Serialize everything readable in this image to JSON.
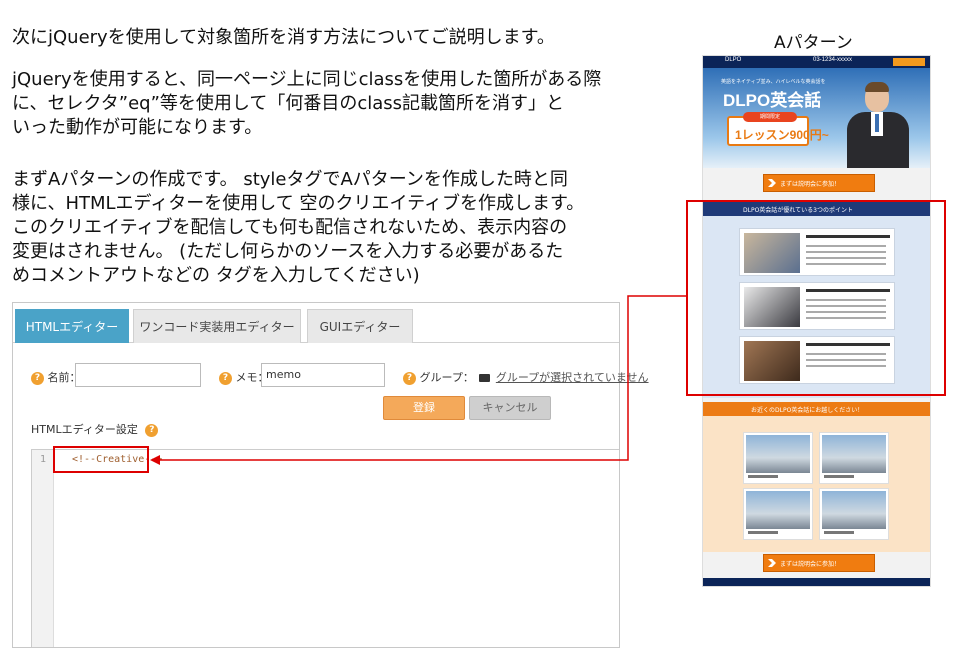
{
  "intro": {
    "p1": "次にjQueryを使用して対象箇所を消す方法についてご説明します。",
    "p2_lines": [
      "jQueryを使用すると、同一ページ上に同じclassを使用した箇所がある際",
      "に、セレクタ”eq”等を使用して「何番目のclass記載箇所を消す」と",
      "いった動作が可能になります。"
    ],
    "p3_lines": [
      "まずAパターンの作成です。 styleタグでAパターンを作成した時と同",
      "様に、HTMLエディターを使用して 空のクリエイティブを作成します。",
      "このクリエイティブを配信しても何も配信されないため、表示内容の",
      "変更はされません。 (ただし何らかのソースを入力する必要があるた",
      "めコメントアウトなどの タグを入力してください)"
    ]
  },
  "editor": {
    "tabs": [
      "HTMLエディター",
      "ワンコード実装用エディター",
      "GUIエディター"
    ],
    "name_label": "名前：",
    "name_value": "",
    "memo_label": "メモ：",
    "memo_value": "memo",
    "group_label": "グループ：",
    "group_link": "グループが選択されていません",
    "register_label": "登録",
    "cancel_label": "キャンセル",
    "settings_label": "HTMLエディター設定",
    "line_number": "1",
    "code": "<!--Creative-->"
  },
  "preview": {
    "title": "Aパターン",
    "logo": "DLPO",
    "phone": "03-1234-xxxxx",
    "hero_small": "英語をネイティブ並み、ハイレベルな英会話を",
    "hero_title": "DLPO英会話",
    "price_tag": "期間限定",
    "price": "1レッスン900円~",
    "cta": "まずは説明会に参加！",
    "points_title": "DLPO英会話が優れている3つのポイント",
    "branch_title": "お近くのDLPO英会話にお越しください！"
  },
  "colors": {
    "tab_active": "#4aa3c8",
    "register": "#f4a95a",
    "highlight": "#dd0000",
    "preview_navy": "#0b2458",
    "preview_orange": "#ec7b14"
  }
}
